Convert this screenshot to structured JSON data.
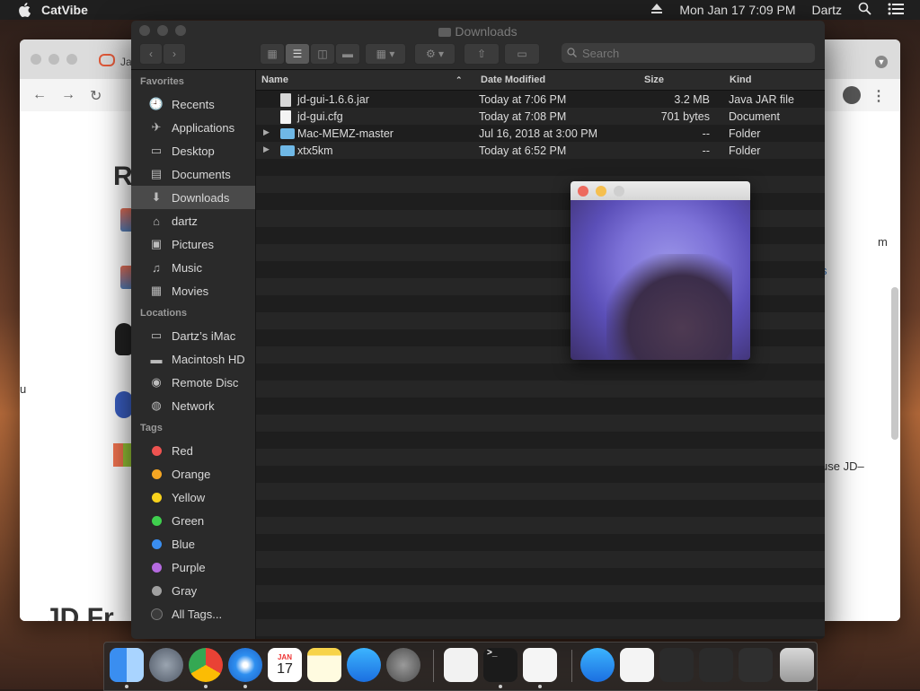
{
  "menubar": {
    "app_name": "CatVibe",
    "date_time": "Mon Jan 17  7:09 PM",
    "user": "Dartz"
  },
  "browser": {
    "tab_fragment": "Ja",
    "heading_fragment": "R",
    "right_fragment_1": "m",
    "right_fragment_2": "s",
    "right_fragment_3": "use JD–",
    "left_fragment": "u",
    "bottom_fragment": "JD Fr"
  },
  "finder": {
    "title": "Downloads",
    "search_placeholder": "Search",
    "sidebar": {
      "favorites_label": "Favorites",
      "favorites": [
        {
          "label": "Recents",
          "icon": "recents-icon"
        },
        {
          "label": "Applications",
          "icon": "applications-icon"
        },
        {
          "label": "Desktop",
          "icon": "desktop-icon"
        },
        {
          "label": "Documents",
          "icon": "documents-icon"
        },
        {
          "label": "Downloads",
          "icon": "downloads-icon"
        },
        {
          "label": "dartz",
          "icon": "home-icon"
        },
        {
          "label": "Pictures",
          "icon": "pictures-icon"
        },
        {
          "label": "Music",
          "icon": "music-icon"
        },
        {
          "label": "Movies",
          "icon": "movies-icon"
        }
      ],
      "locations_label": "Locations",
      "locations": [
        {
          "label": "Dartz’s iMac",
          "icon": "imac-icon"
        },
        {
          "label": "Macintosh HD",
          "icon": "hard-drive-icon"
        },
        {
          "label": "Remote Disc",
          "icon": "disc-icon"
        },
        {
          "label": "Network",
          "icon": "network-icon"
        }
      ],
      "tags_label": "Tags",
      "tags": [
        {
          "label": "Red",
          "color": "#ee5350"
        },
        {
          "label": "Orange",
          "color": "#f5a623"
        },
        {
          "label": "Yellow",
          "color": "#f8d21c"
        },
        {
          "label": "Green",
          "color": "#3fcf4e"
        },
        {
          "label": "Blue",
          "color": "#3a8ef0"
        },
        {
          "label": "Purple",
          "color": "#b56ae0"
        },
        {
          "label": "Gray",
          "color": "#a0a0a0"
        },
        {
          "label": "All Tags...",
          "color": "#555555"
        }
      ]
    },
    "columns": {
      "name": "Name",
      "date": "Date Modified",
      "size": "Size",
      "kind": "Kind"
    },
    "files": [
      {
        "name": "jd-gui-1.6.6.jar",
        "date": "Today at 7:06 PM",
        "size": "3.2 MB",
        "kind": "Java JAR file",
        "type": "jar"
      },
      {
        "name": "jd-gui.cfg",
        "date": "Today at 7:08 PM",
        "size": "701 bytes",
        "kind": "Document",
        "type": "doc"
      },
      {
        "name": "Mac-MEMZ-master",
        "date": "Jul 16, 2018 at 3:00 PM",
        "size": "--",
        "kind": "Folder",
        "type": "folder"
      },
      {
        "name": "xtx5km",
        "date": "Today at 6:52 PM",
        "size": "--",
        "kind": "Folder",
        "type": "folder"
      }
    ]
  },
  "dock": {
    "calendar_month": "JAN",
    "calendar_day": "17",
    "apps": [
      "finder-icon",
      "launchpad-icon",
      "chrome-icon",
      "safari-icon",
      "calendar-icon",
      "notes-icon",
      "app-store-icon",
      "system-preferences-icon",
      "textedit-icon",
      "terminal-icon",
      "java-icon",
      "app-store-folder-icon",
      "document-icon",
      "folder-stack-icon",
      "downloads-stack-icon",
      "window-stack-icon",
      "trash-icon"
    ]
  }
}
